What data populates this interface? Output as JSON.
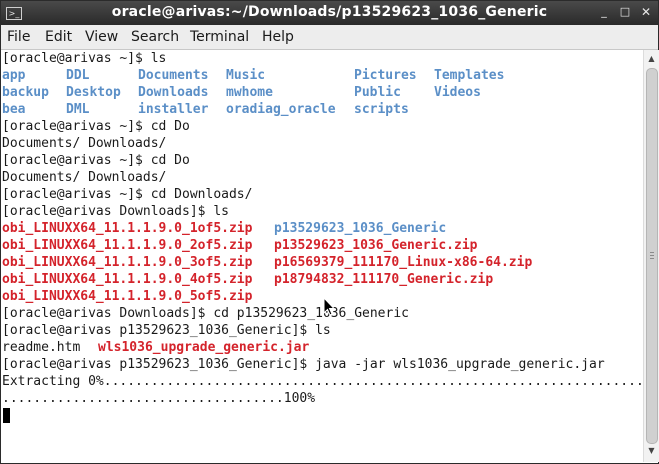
{
  "window": {
    "title": "oracle@arivas:~/Downloads/p13529623_1036_Generic",
    "controls": {
      "minimize": "_",
      "maximize": "□",
      "close": "✕"
    }
  },
  "menu": [
    "File",
    "Edit",
    "View",
    "Search",
    "Terminal",
    "Help"
  ],
  "terminal": {
    "lines": [
      [
        {
          "text": "[oracle@arivas ~]$ ls",
          "style": "plain"
        }
      ],
      [
        {
          "text": "app",
          "style": "dir"
        },
        {
          "text": "DDL",
          "style": "dir"
        },
        {
          "text": "Documents",
          "style": "dir"
        },
        {
          "text": "Music",
          "style": "dir"
        },
        {
          "text": "Pictures",
          "style": "dir"
        },
        {
          "text": "Templates",
          "style": "dir"
        }
      ],
      [
        {
          "text": "backup",
          "style": "dir"
        },
        {
          "text": "Desktop",
          "style": "dir"
        },
        {
          "text": "Downloads",
          "style": "dir"
        },
        {
          "text": "mwhome",
          "style": "dir"
        },
        {
          "text": "Public",
          "style": "dir"
        },
        {
          "text": "Videos",
          "style": "dir"
        }
      ],
      [
        {
          "text": "bea",
          "style": "dir"
        },
        {
          "text": "DML",
          "style": "dir"
        },
        {
          "text": "installer",
          "style": "dir"
        },
        {
          "text": "oradiag_oracle",
          "style": "dir"
        },
        {
          "text": "scripts",
          "style": "dir"
        }
      ],
      [
        {
          "text": "[oracle@arivas ~]$ cd Do",
          "style": "plain"
        }
      ],
      [
        {
          "text": "Documents/ Downloads/",
          "style": "plain"
        }
      ],
      [
        {
          "text": "[oracle@arivas ~]$ cd Do",
          "style": "plain"
        }
      ],
      [
        {
          "text": "Documents/ Downloads/",
          "style": "plain"
        }
      ],
      [
        {
          "text": "[oracle@arivas ~]$ cd Downloads/",
          "style": "plain"
        }
      ],
      [
        {
          "text": "[oracle@arivas Downloads]$ ls",
          "style": "plain"
        }
      ],
      [
        {
          "text": "obi_LINUXX64_11.1.1.9.0_1of5.zip",
          "style": "zip"
        },
        {
          "text": "p13529623_1036_Generic",
          "style": "dir"
        }
      ],
      [
        {
          "text": "obi_LINUXX64_11.1.1.9.0_2of5.zip",
          "style": "zip"
        },
        {
          "text": "p13529623_1036_Generic.zip",
          "style": "zip"
        }
      ],
      [
        {
          "text": "obi_LINUXX64_11.1.1.9.0_3of5.zip",
          "style": "zip"
        },
        {
          "text": "p16569379_111170_Linux-x86-64.zip",
          "style": "zip"
        }
      ],
      [
        {
          "text": "obi_LINUXX64_11.1.1.9.0_4of5.zip",
          "style": "zip"
        },
        {
          "text": "p18794832_111170_Generic.zip",
          "style": "zip"
        }
      ],
      [
        {
          "text": "obi_LINUXX64_11.1.1.9.0_5of5.zip",
          "style": "zip"
        }
      ],
      [
        {
          "text": "[oracle@arivas Downloads]$ cd p13529623_1036_Generic",
          "style": "plain"
        }
      ],
      [
        {
          "text": "[oracle@arivas p13529623_1036_Generic]$ ls",
          "style": "plain"
        }
      ],
      [
        {
          "text": "readme.htm",
          "style": "plain"
        },
        {
          "text": "wls1036_upgrade_generic.jar",
          "style": "zip"
        }
      ],
      [
        {
          "text": "[oracle@arivas p13529623_1036_Generic]$ java -jar wls1036_upgrade_generic.jar",
          "style": "plain"
        }
      ],
      [
        {
          "text": "Extracting 0%..........................................................................",
          "style": "plain"
        }
      ],
      [
        {
          "text": "....................................100%",
          "style": "plain"
        }
      ]
    ]
  }
}
